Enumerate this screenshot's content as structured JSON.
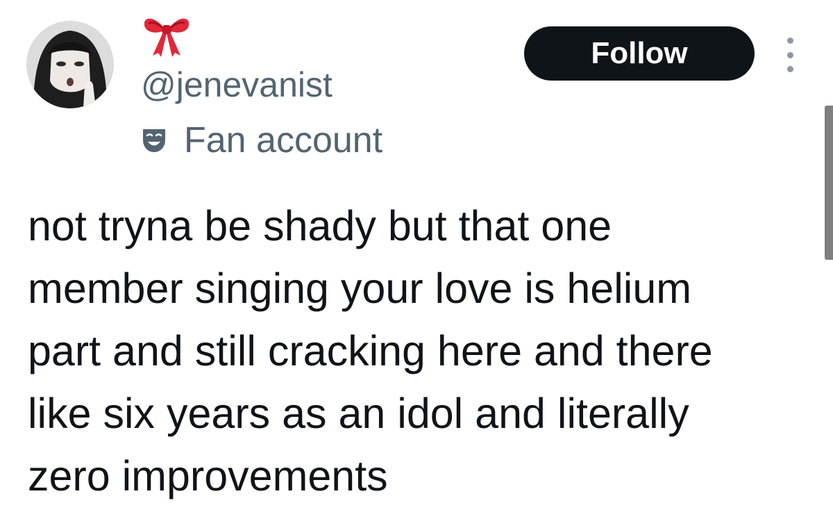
{
  "tweet": {
    "display_name_emoji": "🎀",
    "handle": "@jenevanist",
    "account_label": "Fan account",
    "follow_label": "Follow",
    "text": "not tryna be shady but that one\nmember singing your love is helium\npart and still cracking here and there\nlike six years as an idol and literally\nzero improvements"
  },
  "icons": {
    "avatar": "avatar-photo",
    "display_name": "ribbon-icon",
    "label": "theater-mask-icon",
    "more": "more-vertical-icon"
  },
  "colors": {
    "text_primary": "#0f1419",
    "text_secondary": "#536471",
    "follow_bg": "#0f1419",
    "follow_text": "#ffffff",
    "ribbon": "#e0283a"
  }
}
